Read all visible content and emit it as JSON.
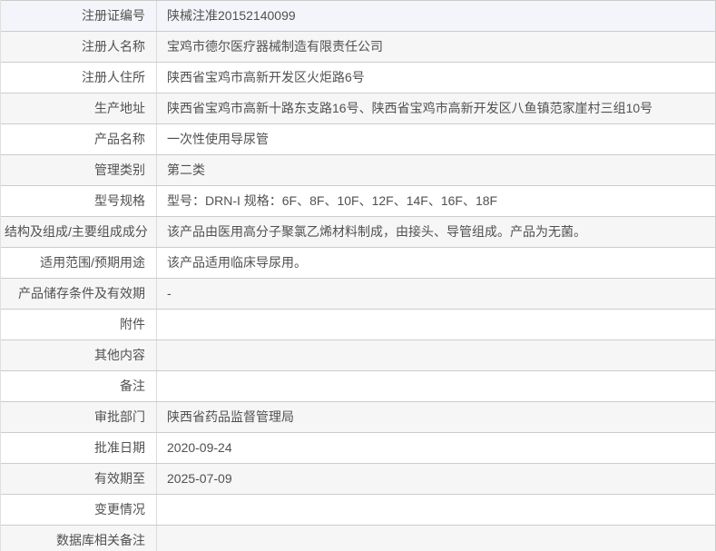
{
  "colors": {
    "row_highlight": "#f3f5fa",
    "row_stripe": "#f6f6f6",
    "row_plain": "#ffffff",
    "border": "#cccccc",
    "divider": "#dcdcdc",
    "text": "#515151"
  },
  "table": {
    "rows": [
      {
        "label": "注册证编号",
        "value": "陕械注准20152140099"
      },
      {
        "label": "注册人名称",
        "value": "宝鸡市德尔医疗器械制造有限责任公司"
      },
      {
        "label": "注册人住所",
        "value": "陕西省宝鸡市高新开发区火炬路6号"
      },
      {
        "label": "生产地址",
        "value": "陕西省宝鸡市高新十路东支路16号、陕西省宝鸡市高新开发区八鱼镇范家崖村三组10号"
      },
      {
        "label": "产品名称",
        "value": "一次性使用导尿管"
      },
      {
        "label": "管理类别",
        "value": "第二类"
      },
      {
        "label": "型号规格",
        "value": "型号：DRN-I 规格：6F、8F、10F、12F、14F、16F、18F"
      },
      {
        "label": "结构及组成/主要组成成分",
        "value": "该产品由医用高分子聚氯乙烯材料制成，由接头、导管组成。产品为无菌。"
      },
      {
        "label": "适用范围/预期用途",
        "value": "该产品适用临床导尿用。"
      },
      {
        "label": "产品储存条件及有效期",
        "value": "-"
      },
      {
        "label": "附件",
        "value": ""
      },
      {
        "label": "其他内容",
        "value": ""
      },
      {
        "label": "备注",
        "value": ""
      },
      {
        "label": "审批部门",
        "value": "陕西省药品监督管理局"
      },
      {
        "label": "批准日期",
        "value": "2020-09-24"
      },
      {
        "label": "有效期至",
        "value": "2025-07-09"
      },
      {
        "label": "变更情况",
        "value": ""
      },
      {
        "label": "数据库相关备注",
        "value": ""
      }
    ]
  }
}
